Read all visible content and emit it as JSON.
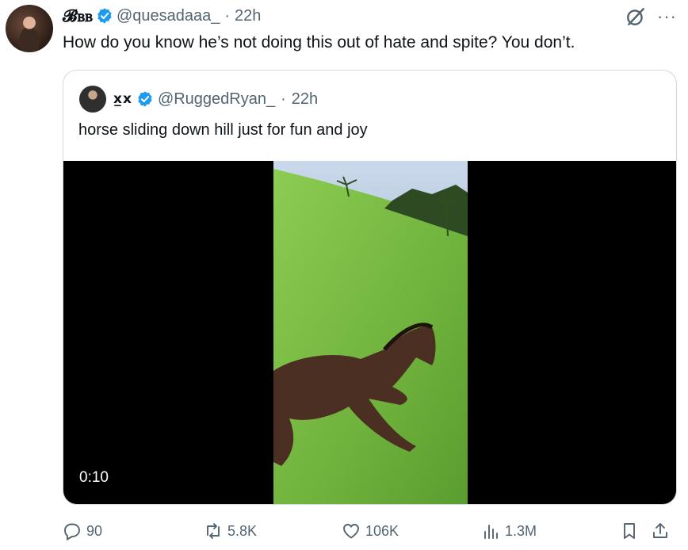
{
  "tweet": {
    "display_name": "𝓑ᏼᏼ",
    "handle": "@quesadaaa_",
    "separator": "·",
    "time": "22h",
    "text": "How do you know he’s not doing this out of hate and spite? You don’t.",
    "more_glyph": "···"
  },
  "quote": {
    "display_name": "x̲x",
    "handle": "@RuggedRyan_",
    "separator": "·",
    "time": "22h",
    "text": "horse sliding down hill just for fun and joy",
    "video_duration": "0:10"
  },
  "actions": {
    "replies": "90",
    "reposts": "5.8K",
    "likes": "106K",
    "views": "1.3M"
  },
  "colors": {
    "verified": "#1d9bf0",
    "muted": "#536471",
    "border": "#cfd9de",
    "grass": "#7cc04a"
  }
}
